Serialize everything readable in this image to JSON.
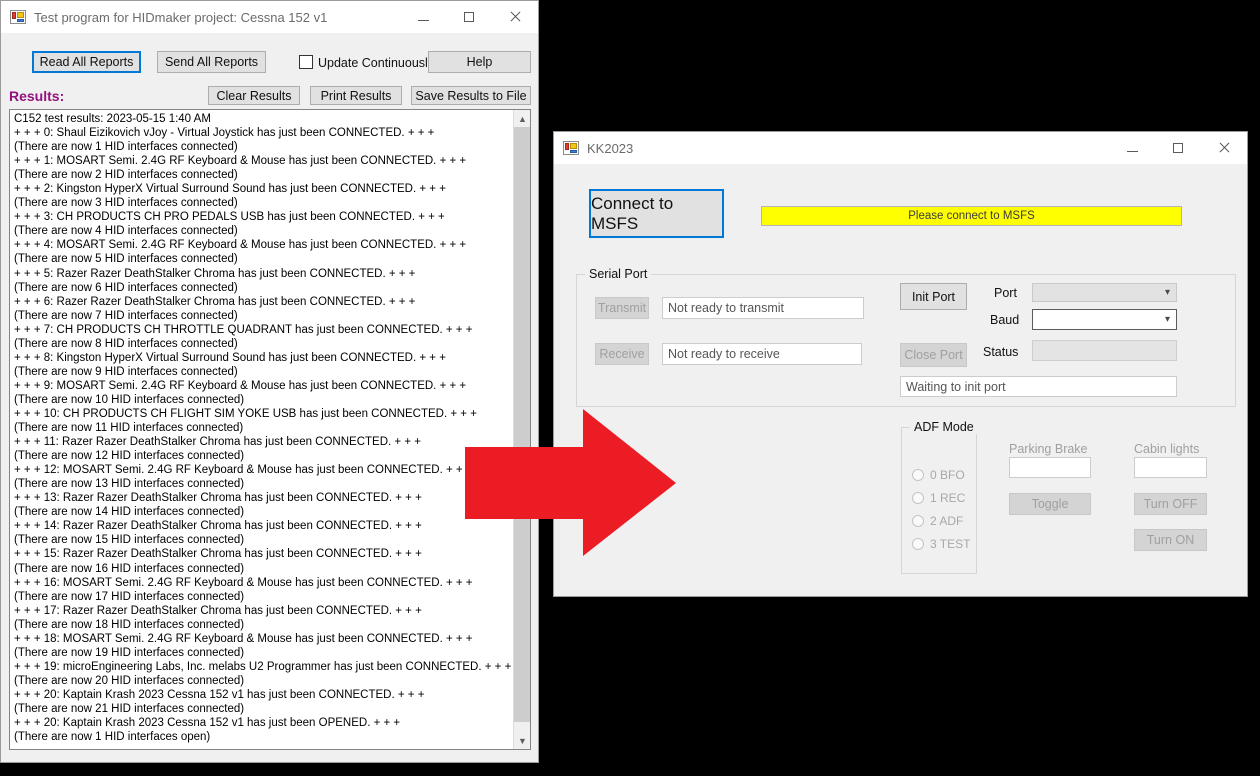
{
  "hidmaker_window": {
    "title": "Test program for HIDmaker project: Cessna 152 v1",
    "icon": "winforms-app-icon",
    "window_controls": {
      "minimize": "minimize-icon",
      "maximize": "maximize-icon",
      "close": "close-icon"
    },
    "toolbar": {
      "read_all_reports": "Read All Reports",
      "send_all_reports": "Send All Reports",
      "update_continuously": "Update Continuously",
      "help": "Help",
      "clear_results": "Clear Results",
      "print_results": "Print Results",
      "save_results_to_file": "Save Results to File"
    },
    "results_label": "Results:",
    "results_lines": [
      "C152 test results:  2023-05-15 1:40 AM",
      "+ + + 0: Shaul Eizikovich vJoy - Virtual Joystick has just been CONNECTED. + + +",
      "(There are now 1 HID interfaces connected)",
      "+ + + 1: MOSART Semi. 2.4G RF Keyboard & Mouse has just been CONNECTED. + + +",
      "(There are now 2 HID interfaces connected)",
      "+ + + 2: Kingston HyperX Virtual Surround Sound has just been CONNECTED. + + +",
      "(There are now 3 HID interfaces connected)",
      "+ + + 3: CH PRODUCTS CH PRO PEDALS USB  has just been CONNECTED. + + +",
      "(There are now 4 HID interfaces connected)",
      "+ + + 4: MOSART Semi. 2.4G RF Keyboard & Mouse has just been CONNECTED. + + +",
      "(There are now 5 HID interfaces connected)",
      "+ + + 5: Razer Razer DeathStalker Chroma has just been CONNECTED. + + +",
      "(There are now 6 HID interfaces connected)",
      "+ + + 6: Razer Razer DeathStalker Chroma has just been CONNECTED. + + +",
      "(There are now 7 HID interfaces connected)",
      "+ + + 7: CH PRODUCTS CH THROTTLE QUADRANT has just been CONNECTED. + + +",
      "(There are now 8 HID interfaces connected)",
      "+ + + 8: Kingston HyperX Virtual Surround Sound has just been CONNECTED. + + +",
      "(There are now 9 HID interfaces connected)",
      "+ + + 9: MOSART Semi. 2.4G RF Keyboard & Mouse has just been CONNECTED. + + +",
      "(There are now 10 HID interfaces connected)",
      "+ + + 10: CH PRODUCTS CH FLIGHT SIM YOKE USB  has just been CONNECTED. + + +",
      "(There are now 11 HID interfaces connected)",
      "+ + + 11: Razer Razer DeathStalker Chroma has just been CONNECTED. + + +",
      "(There are now 12 HID interfaces connected)",
      "+ + + 12: MOSART Semi. 2.4G RF Keyboard & Mouse has just been CONNECTED. + + +",
      "(There are now 13 HID interfaces connected)",
      "+ + + 13: Razer Razer DeathStalker Chroma has just been CONNECTED. + + +",
      "(There are now 14 HID interfaces connected)",
      "+ + + 14: Razer Razer DeathStalker Chroma has just been CONNECTED. + + +",
      "(There are now 15 HID interfaces connected)",
      "+ + + 15: Razer Razer DeathStalker Chroma has just been CONNECTED. + + +",
      "(There are now 16 HID interfaces connected)",
      "+ + + 16: MOSART Semi. 2.4G RF Keyboard & Mouse has just been CONNECTED. + + +",
      "(There are now 17 HID interfaces connected)",
      "+ + + 17: Razer Razer DeathStalker Chroma has just been CONNECTED. + + +",
      "(There are now 18 HID interfaces connected)",
      "+ + + 18: MOSART Semi. 2.4G RF Keyboard & Mouse has just been CONNECTED. + + +",
      "(There are now 19 HID interfaces connected)",
      "+ + + 19: microEngineering Labs, Inc. melabs U2 Programmer has just been CONNECTED. + + +",
      "(There are now 20 HID interfaces connected)",
      "+ + + 20: Kaptain Krash 2023 Cessna 152 v1 has just been CONNECTED. + + +",
      "(There are now 21 HID interfaces connected)",
      "+ + + 20: Kaptain Krash 2023 Cessna 152 v1 has just been OPENED. + + +",
      "(There are now 1 HID interfaces open)"
    ],
    "scrollbar": {
      "up_arrow": "chevron-up-icon",
      "down_arrow": "chevron-down-icon"
    }
  },
  "kk2023_window": {
    "title": "KK2023",
    "icon": "winforms-app-icon",
    "window_controls": {
      "minimize": "minimize-icon",
      "maximize": "maximize-icon",
      "close": "close-icon"
    },
    "connect_button": "Connect to MSFS",
    "status_banner": {
      "text": "Please connect to MSFS",
      "background": "#ffff00"
    },
    "serial_port": {
      "group_title": "Serial Port",
      "transmit_button": "Transmit",
      "transmit_value": "Not ready to transmit",
      "receive_button": "Receive",
      "receive_value": "Not ready to receive",
      "init_port_button": "Init Port",
      "close_port_button": "Close Port",
      "port_label": "Port",
      "port_value": "",
      "baud_label": "Baud",
      "baud_value": "",
      "status_label": "Status",
      "status_value": "",
      "init_status_value": "Waiting to init port",
      "dropdown_icon": "chevron-down-icon"
    },
    "adf_mode": {
      "group_title": "ADF Mode",
      "options": [
        "0 BFO",
        "1 REC",
        "2 ADF",
        "3 TEST"
      ]
    },
    "parking_brake": {
      "label": "Parking Brake",
      "value": "",
      "toggle_button": "Toggle"
    },
    "cabin_lights": {
      "label": "Cabin lights",
      "value": "",
      "turn_off_button": "Turn OFF",
      "turn_on_button": "Turn ON"
    }
  },
  "annotation": {
    "arrow": "red-right-arrow",
    "color": "#ec1c24"
  }
}
